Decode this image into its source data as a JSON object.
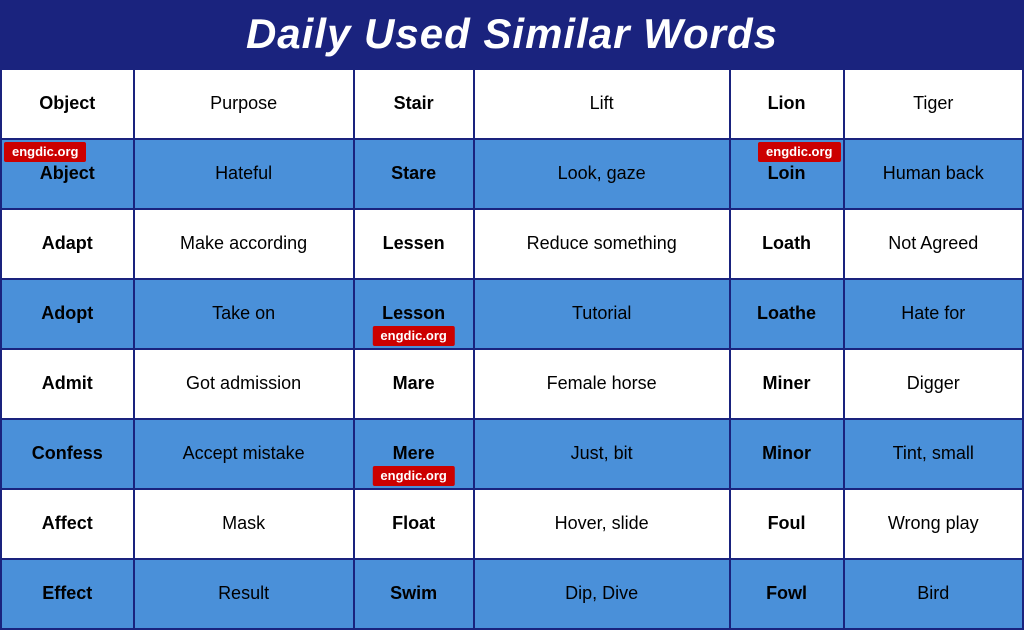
{
  "header": {
    "title": "Daily Used Similar Words"
  },
  "table": {
    "rows": [
      {
        "style": "white",
        "cells": [
          {
            "text": "Object",
            "bold": true
          },
          {
            "text": "Purpose",
            "bold": false
          },
          {
            "text": "Stair",
            "bold": true
          },
          {
            "text": "Lift",
            "bold": false
          },
          {
            "text": "Lion",
            "bold": true
          },
          {
            "text": "Tiger",
            "bold": false
          }
        ]
      },
      {
        "style": "blue",
        "cells": [
          {
            "text": "Abject",
            "bold": true,
            "badge": {
              "text": "engdic.org",
              "pos": "badge-top-left"
            }
          },
          {
            "text": "Hateful",
            "bold": false
          },
          {
            "text": "Stare",
            "bold": true
          },
          {
            "text": "Look, gaze",
            "bold": false
          },
          {
            "text": "Loin",
            "bold": true,
            "badge": {
              "text": "engdic.org",
              "pos": "badge-top-right"
            }
          },
          {
            "text": "Human back",
            "bold": false
          }
        ]
      },
      {
        "style": "white",
        "cells": [
          {
            "text": "Adapt",
            "bold": true
          },
          {
            "text": "Make according",
            "bold": false
          },
          {
            "text": "Lessen",
            "bold": true
          },
          {
            "text": "Reduce something",
            "bold": false
          },
          {
            "text": "Loath",
            "bold": true
          },
          {
            "text": "Not Agreed",
            "bold": false
          }
        ]
      },
      {
        "style": "blue",
        "cells": [
          {
            "text": "Adopt",
            "bold": true
          },
          {
            "text": "Take on",
            "bold": false
          },
          {
            "text": "Lesson",
            "bold": true,
            "badge": {
              "text": "engdic.org",
              "pos": "badge-mid-center"
            }
          },
          {
            "text": "Tutorial",
            "bold": false
          },
          {
            "text": "Loathe",
            "bold": true
          },
          {
            "text": "Hate for",
            "bold": false
          }
        ]
      },
      {
        "style": "white",
        "cells": [
          {
            "text": "Admit",
            "bold": true
          },
          {
            "text": "Got admission",
            "bold": false
          },
          {
            "text": "Mare",
            "bold": true
          },
          {
            "text": "Female horse",
            "bold": false
          },
          {
            "text": "Miner",
            "bold": true
          },
          {
            "text": "Digger",
            "bold": false
          }
        ]
      },
      {
        "style": "blue",
        "cells": [
          {
            "text": "Confess",
            "bold": true
          },
          {
            "text": "Accept mistake",
            "bold": false
          },
          {
            "text": "Mere",
            "bold": true,
            "badge": {
              "text": "engdic.org",
              "pos": "badge-mid-center"
            }
          },
          {
            "text": "Just, bit",
            "bold": false
          },
          {
            "text": "Minor",
            "bold": true
          },
          {
            "text": "Tint, small",
            "bold": false
          }
        ]
      },
      {
        "style": "white",
        "cells": [
          {
            "text": "Affect",
            "bold": true
          },
          {
            "text": "Mask",
            "bold": false
          },
          {
            "text": "Float",
            "bold": true
          },
          {
            "text": "Hover, slide",
            "bold": false
          },
          {
            "text": "Foul",
            "bold": true
          },
          {
            "text": "Wrong play",
            "bold": false
          }
        ]
      },
      {
        "style": "blue",
        "cells": [
          {
            "text": "Effect",
            "bold": true
          },
          {
            "text": "Result",
            "bold": false
          },
          {
            "text": "Swim",
            "bold": true
          },
          {
            "text": "Dip, Dive",
            "bold": false
          },
          {
            "text": "Fowl",
            "bold": true
          },
          {
            "text": "Bird",
            "bold": false
          }
        ]
      }
    ]
  }
}
